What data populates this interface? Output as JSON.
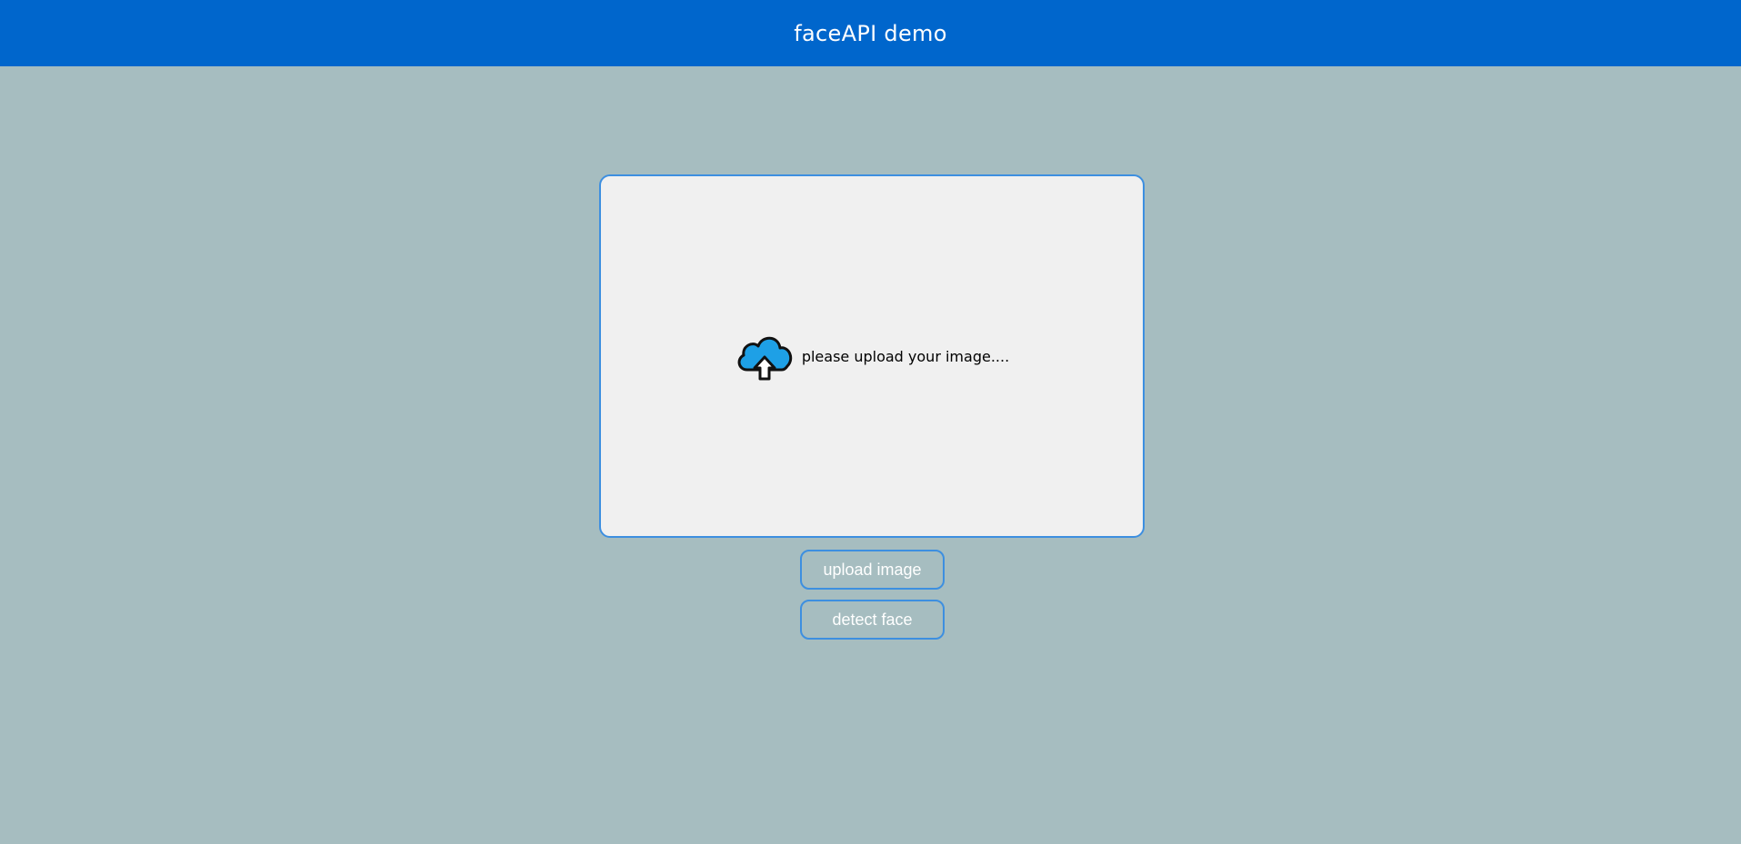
{
  "header": {
    "title": "faceAPI demo",
    "background_color": "#0066cc"
  },
  "upload_area": {
    "icon": "cloud-upload-icon",
    "prompt": "please upload your image...."
  },
  "buttons": {
    "upload_label": "upload image",
    "detect_label": "detect face"
  },
  "colors": {
    "page_background": "#a6bdc0",
    "accent_border": "#3d8fe0",
    "icon_blue": "#1ea0e6"
  }
}
